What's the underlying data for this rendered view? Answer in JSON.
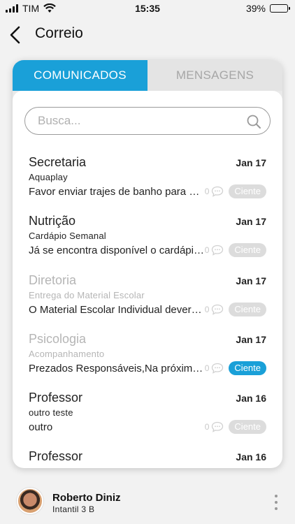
{
  "status_bar": {
    "carrier": "TIM",
    "time": "15:35",
    "battery": "39%",
    "battery_level": 0.39
  },
  "header": {
    "title": "Correio"
  },
  "tabs": [
    {
      "label": "COMUNICADOS",
      "active": true
    },
    {
      "label": "MENSAGENS",
      "active": false
    }
  ],
  "search": {
    "placeholder": "Busca..."
  },
  "messages": [
    {
      "sender": "Secretaria",
      "subject": "Aquaplay",
      "preview": "Favor enviar trajes de banho para as aulas",
      "date": "Jan 17",
      "count": "0",
      "ciente": "Ciente",
      "read": false,
      "acknowledged": false
    },
    {
      "sender": "Nutrição",
      "subject": "Cardápio Semanal",
      "preview": "Já se encontra disponível o cardápio semanal",
      "date": "Jan 17",
      "count": "0",
      "ciente": "Ciente",
      "read": false,
      "acknowledged": false
    },
    {
      "sender": "Diretoria",
      "subject": "Entrega do Material Escolar",
      "preview": "O Material Escolar Individual deverá ser entregue",
      "date": "Jan 17",
      "count": "0",
      "ciente": "Ciente",
      "read": true,
      "acknowledged": false
    },
    {
      "sender": "Psicologia",
      "subject": "Acompanhamento",
      "preview": "Prezados Responsáveis,Na próxima semana",
      "date": "Jan 17",
      "count": "0",
      "ciente": "Ciente",
      "read": true,
      "acknowledged": true
    },
    {
      "sender": "Professor",
      "subject": "outro teste",
      "preview": "outro",
      "date": "Jan 16",
      "count": "0",
      "ciente": "Ciente",
      "read": false,
      "acknowledged": false
    },
    {
      "sender": "Professor",
      "subject": "",
      "preview": "",
      "date": "Jan 16",
      "count": "",
      "ciente": "",
      "read": false,
      "acknowledged": false
    }
  ],
  "user": {
    "name": "Roberto Diniz",
    "class": "Intantil 3 B"
  },
  "colors": {
    "accent": "#1aa0d8",
    "muted": "#b5b5b5"
  }
}
